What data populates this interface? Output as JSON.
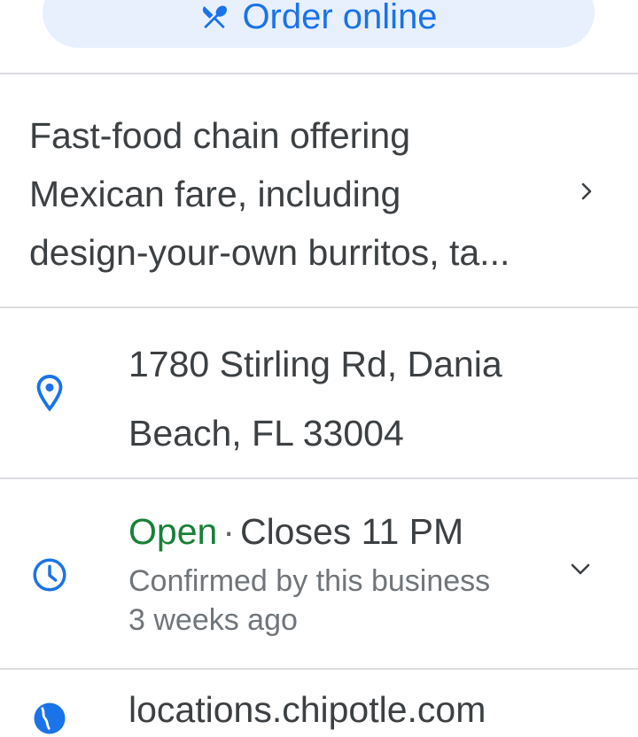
{
  "actions": {
    "order_online_label": "Order online"
  },
  "description": {
    "lines": [
      "Fast-food chain offering",
      "Mexican fare, including",
      "design-your-own burritos, ta..."
    ]
  },
  "address": {
    "line1": "1780 Stirling Rd, Dania",
    "line2": "Beach, FL 33004"
  },
  "hours": {
    "status": "Open",
    "separator": "·",
    "closes": "Closes 11 PM",
    "confirmed_line1": "Confirmed by this business",
    "confirmed_line2": "3 weeks ago"
  },
  "website": {
    "text": "locations.chipotle.com"
  },
  "icons": {
    "order": "utensils-icon",
    "description_more": "chevron-right-icon",
    "address": "location-pin-icon",
    "hours": "clock-icon",
    "hours_expand": "chevron-down-icon",
    "website": "globe-icon"
  },
  "colors": {
    "accent": "#1a73e8",
    "button_bg": "#e8f0fe",
    "open_status": "#188038",
    "secondary_text": "#70757a",
    "divider": "#dadce0"
  }
}
